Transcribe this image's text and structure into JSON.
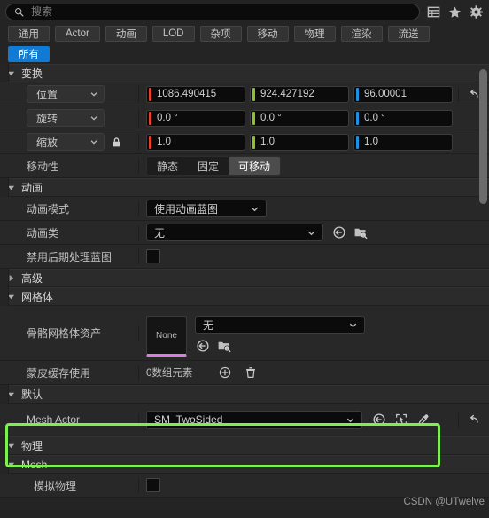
{
  "search": {
    "placeholder": "搜索",
    "value": "",
    "icon": "search-icon"
  },
  "header_icons": [
    {
      "name": "grid-view-icon",
      "label": ""
    },
    {
      "name": "star-icon",
      "label": ""
    },
    {
      "name": "gear-icon",
      "label": ""
    }
  ],
  "filter_tabs": [
    {
      "label": "通用",
      "active": false
    },
    {
      "label": "Actor",
      "active": false
    },
    {
      "label": "动画",
      "active": false
    },
    {
      "label": "LOD",
      "active": false
    },
    {
      "label": "杂项",
      "active": false
    },
    {
      "label": "移动",
      "active": false
    },
    {
      "label": "物理",
      "active": false
    },
    {
      "label": "渲染",
      "active": false
    },
    {
      "label": "流送",
      "active": false
    }
  ],
  "all_button": {
    "label": "所有",
    "active": true
  },
  "sections": {
    "transform": {
      "title": "变换",
      "expanded": true,
      "position": {
        "label": "位置",
        "axes": [
          {
            "axis": "X",
            "value": "1086.490415",
            "color": "#e8422f"
          },
          {
            "axis": "Y",
            "value": "924.427192",
            "color": "#8bc22a"
          },
          {
            "axis": "Z",
            "value": "96.00001",
            "color": "#1f8fe0"
          }
        ]
      },
      "rotation": {
        "label": "旋转",
        "axes": [
          {
            "axis": "X",
            "value": "0.0 °",
            "color": "#e8422f"
          },
          {
            "axis": "Y",
            "value": "0.0 °",
            "color": "#8bc22a"
          },
          {
            "axis": "Z",
            "value": "0.0 °",
            "color": "#1f8fe0"
          }
        ]
      },
      "scale": {
        "label": "缩放",
        "lock_icon": "lock-icon",
        "axes": [
          {
            "axis": "X",
            "value": "1.0",
            "color": "#e8422f"
          },
          {
            "axis": "Y",
            "value": "1.0",
            "color": "#8bc22a"
          },
          {
            "axis": "Z",
            "value": "1.0",
            "color": "#1f8fe0"
          }
        ]
      },
      "mobility": {
        "label": "移动性",
        "options": [
          {
            "label": "静态",
            "active": false
          },
          {
            "label": "固定",
            "active": false
          },
          {
            "label": "可移动",
            "active": true
          }
        ]
      },
      "revert_icon": "revert-arrow-icon"
    },
    "animation": {
      "title": "动画",
      "expanded": true,
      "anim_mode": {
        "label": "动画模式",
        "value": "使用动画蓝图"
      },
      "anim_class": {
        "label": "动画类",
        "value": "无",
        "icons": [
          "reset-to-default-icon",
          "browse-asset-icon"
        ]
      },
      "disable_postprocess": {
        "label": "禁用后期处理蓝图",
        "checked": false
      },
      "advanced": {
        "title": "高级",
        "expanded": false
      }
    },
    "mesh": {
      "title": "网格体",
      "expanded": true,
      "skeletal_asset": {
        "label": "骨骼网格体资产",
        "thumbnail": "None",
        "value": "无",
        "icons": [
          "reset-to-default-icon",
          "browse-asset-icon"
        ]
      },
      "skin_cache": {
        "label": "蒙皮缓存使用",
        "value": "0数组元素",
        "icons": [
          "add-element-icon",
          "delete-element-icon"
        ]
      }
    },
    "default": {
      "title": "默认",
      "expanded": true,
      "mesh_actor": {
        "label": "Mesh Actor",
        "value": "SM_TwoSided",
        "icons": [
          "reset-to-default-icon",
          "pick-actor-icon",
          "eyedropper-icon"
        ],
        "revert_icon": "revert-arrow-icon",
        "highlight_color": "#7cf04e"
      }
    },
    "physics": {
      "title": "物理",
      "expanded": true
    },
    "mesh2": {
      "title": "Mesh",
      "expanded": true,
      "simulate_physics": {
        "label": "模拟物理",
        "checked": false
      }
    }
  },
  "scrollbar": {
    "name": "vertical-scrollbar"
  },
  "watermark": "CSDN @UTwelve"
}
